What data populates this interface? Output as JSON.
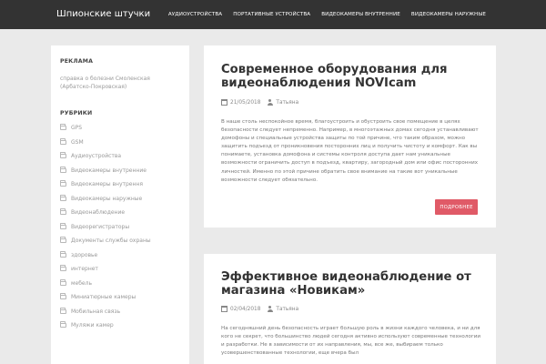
{
  "site": {
    "title": "Шпионские штучки"
  },
  "nav": {
    "items": [
      "АУДИОУСТРОЙСТВА",
      "ПОРТАТИВНЫЕ УСТРОЙСТВА",
      "ВИДЕОКАМЕРЫ ВНУТРЕННИЕ",
      "ВИДЕОКАМЕРЫ НАРУЖНЫЕ"
    ]
  },
  "sidebar": {
    "ad_title": "РЕКЛАМА",
    "ad_link": "справка о болезни Смоленская (Арбатско-Покровская)",
    "categories_title": "РУБРИКИ",
    "categories": [
      "GPS",
      "GSM",
      "Аудиоустройства",
      "Видеокамеры внутренние",
      "Видеокамеры внутрення",
      "Видеокамеры наружные",
      "Видеонаблюдение",
      "Видеорегистраторы",
      "Документы службы охраны",
      "здоровье",
      "интернет",
      "мебель",
      "Миниатюрные камеры",
      "Мобильная связь",
      "Муляжи камер"
    ]
  },
  "posts": [
    {
      "title": "Современное оборудования для видеонаблюдения NOVIcam",
      "date": "21/05/2018",
      "author": "Татьяна",
      "excerpt": "В наше столь неспокойное время, благоустроить и обустроить свое помещение в целях безопасности следует непременно. Например, в многоэтажных домах сегодня устанавливают домофоны и специальные устройства защиты по той причине, что таким образом, можно защитить подъезд от проникновения посторонних лиц и получить чистоту и комфорт. Как вы понимаете, установка домофона и системы контроля доступа дает нам уникальные возможности ограничить доступ в подъезд, квартиру, загородный дом или офис посторонних личностей. Именно по этой причине обратить свое внимание на такие вот уникальные возможности следует обязательно.",
      "read_more": "ПОДРОБНЕЕ"
    },
    {
      "title": "Эффективное видеонаблюдение от магазина «Новикам»",
      "date": "02/04/2018",
      "author": "Татьяна",
      "excerpt": "На сегодняшний день безопасность играет большую роль в жизни каждого человека, и ни для кого не секрет, что большинство людей сегодня активно используют современные технологии и разработки. Не в зависимости от их направления, мы, все же, выбираем только усовершенствованные технологии, еще вчера был"
    }
  ]
}
